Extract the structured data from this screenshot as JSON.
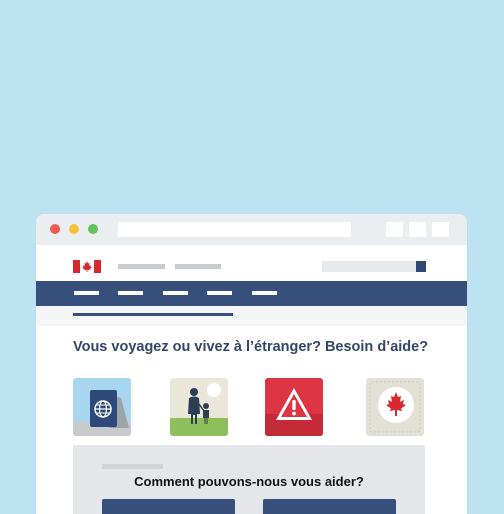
{
  "headline": "Vous voyagez ou vivez à l’étranger? Besoin d’aide?",
  "help": {
    "title": "Comment pouvons-nous vous aider?"
  },
  "tiles": [
    {
      "icon": "passport-icon"
    },
    {
      "icon": "family-icon"
    },
    {
      "icon": "warning-icon"
    },
    {
      "icon": "maple-leaf-icon"
    }
  ],
  "colors": {
    "background": "#bde3f3",
    "nav": "#36507b",
    "headline": "#33466b",
    "flag_red": "#d8282d",
    "alert_red": "#dd3543"
  }
}
